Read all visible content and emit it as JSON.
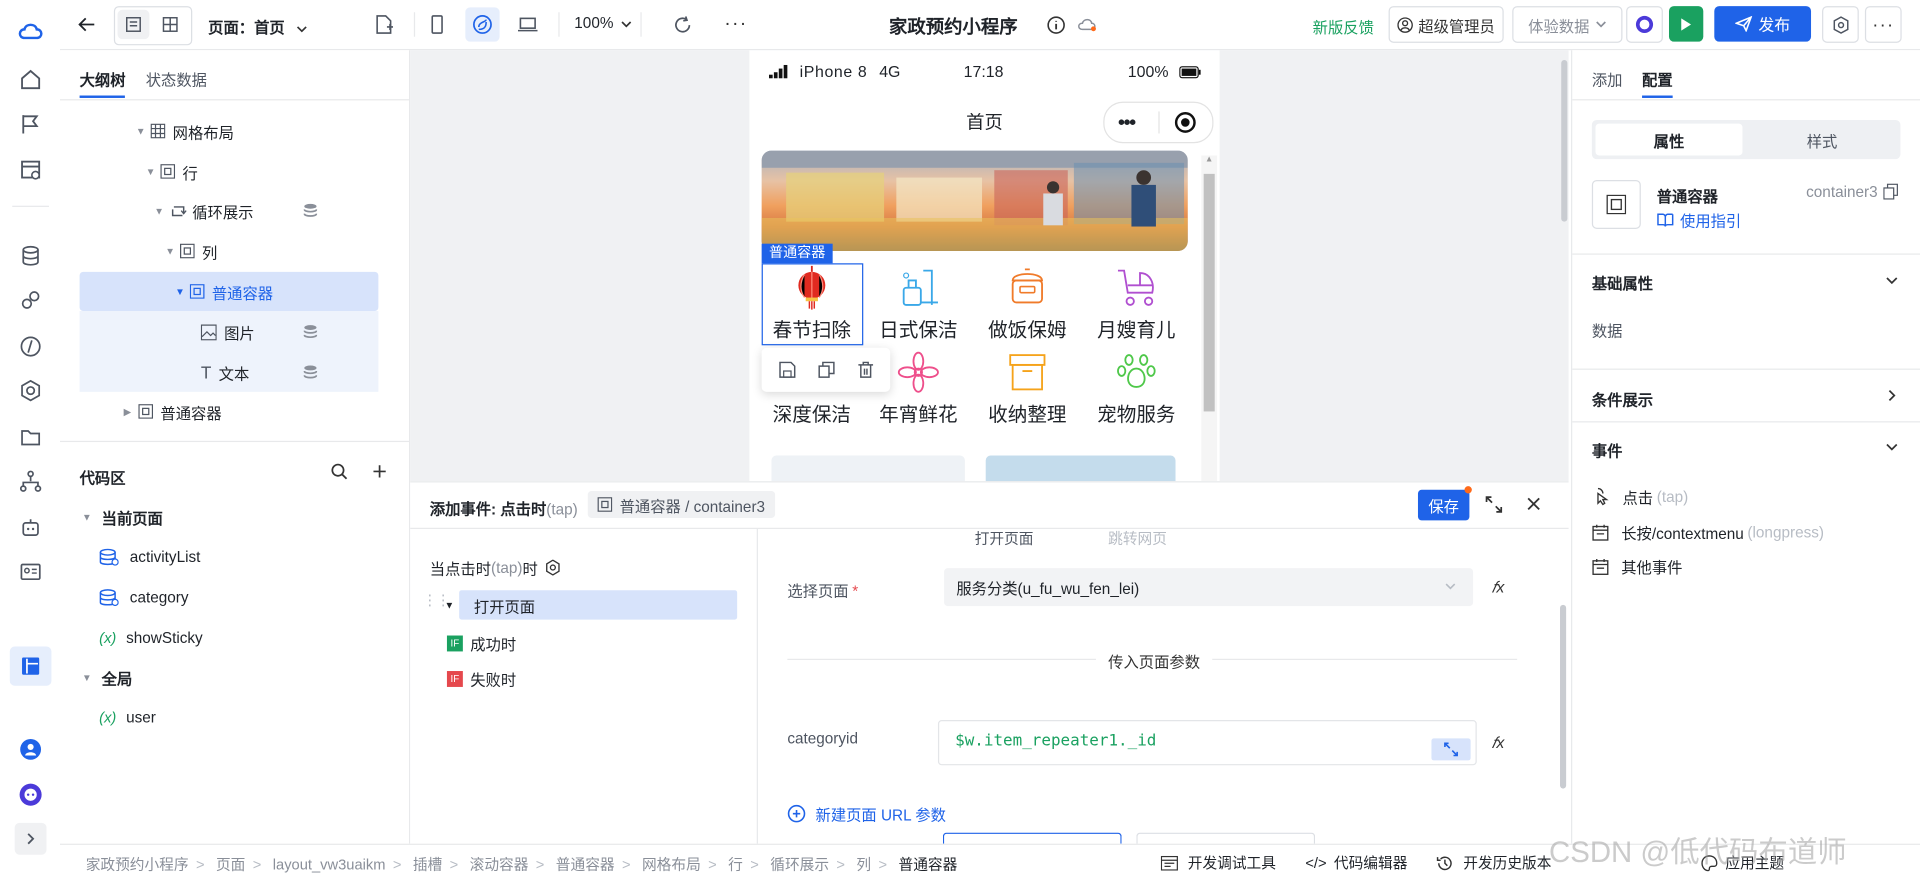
{
  "topbar": {
    "page_label": "页面：首页",
    "zoom": "100%",
    "app_title": "家政预约小程序",
    "feedback": "新版反馈",
    "admin": "超级管理员",
    "data_mode": "体验数据",
    "publish": "发布"
  },
  "left": {
    "tabs": [
      "大纲树",
      "状态数据"
    ],
    "tree": [
      {
        "label": "网格布局",
        "icon": "grid-icon"
      },
      {
        "label": "行",
        "icon": "container-icon"
      },
      {
        "label": "循环展示",
        "icon": "loop-icon"
      },
      {
        "label": "列",
        "icon": "container-icon"
      },
      {
        "label": "普通容器",
        "icon": "container-icon"
      },
      {
        "label": "图片",
        "icon": "image-icon"
      },
      {
        "label": "文本",
        "icon": "text-icon"
      },
      {
        "label": "普通容器",
        "icon": "container-icon"
      }
    ],
    "code_title": "代码区",
    "current_page": "当前页面",
    "code_items": [
      "activityList",
      "category",
      "showSticky"
    ],
    "global": "全局",
    "global_items": [
      "user"
    ]
  },
  "phone": {
    "carrier": "iPhone 8",
    "network": "4G",
    "time": "17:18",
    "battery": "100%",
    "nav_title": "首页",
    "selected_tag": "普通容器",
    "services": [
      "春节扫除",
      "日式保洁",
      "做饭保姆",
      "月嫂育儿",
      "深度保洁",
      "年宵鲜花",
      "收纳整理",
      "宠物服务"
    ]
  },
  "event": {
    "title": "添加事件: 点击时",
    "title_suffix": "(tap)",
    "component_path": "普通容器 / container3",
    "save": "保存",
    "trigger": "当点击时",
    "trigger_suffix": "(tap)",
    "trigger_end": "时",
    "action": "打开页面",
    "success": "成功时",
    "fail": "失败时",
    "mode_tabs": [
      "打开页面",
      "跳转网页"
    ],
    "select_page_label": "选择页面",
    "select_page_value": "服务分类(u_fu_wu_fen_lei)",
    "params_title": "传入页面参数",
    "param_key": "categoryid",
    "param_value": "$w.item_repeater1._id",
    "add_url_param": "新建页面 URL 参数"
  },
  "right": {
    "tabs": [
      "添加",
      "配置"
    ],
    "seg": [
      "属性",
      "样式"
    ],
    "component_name": "普通容器",
    "component_id": "container3",
    "guide": "使用指引",
    "basic_props": "基础属性",
    "data_label": "数据",
    "condition": "条件展示",
    "events_title": "事件",
    "events": [
      {
        "label": "点击",
        "hint": "(tap)"
      },
      {
        "label": "长按/contextmenu",
        "hint": "(longpress)"
      },
      {
        "label": "其他事件",
        "hint": ""
      }
    ]
  },
  "status": {
    "crumbs": [
      "家政预约小程序",
      "页面",
      "layout_vw3uaikm",
      "插槽",
      "滚动容器",
      "普通容器",
      "网格布局",
      "行",
      "循环展示",
      "列",
      "普通容器"
    ],
    "tools": [
      "开发调试工具",
      "代码编辑器",
      "开发历史版本"
    ],
    "theme": "应用主题",
    "watermark": "CSDN @低代码布道师"
  },
  "colors": {
    "primary": "#1f63e8",
    "green": "#1aa160",
    "selected_bg": "#d7e3fb"
  }
}
